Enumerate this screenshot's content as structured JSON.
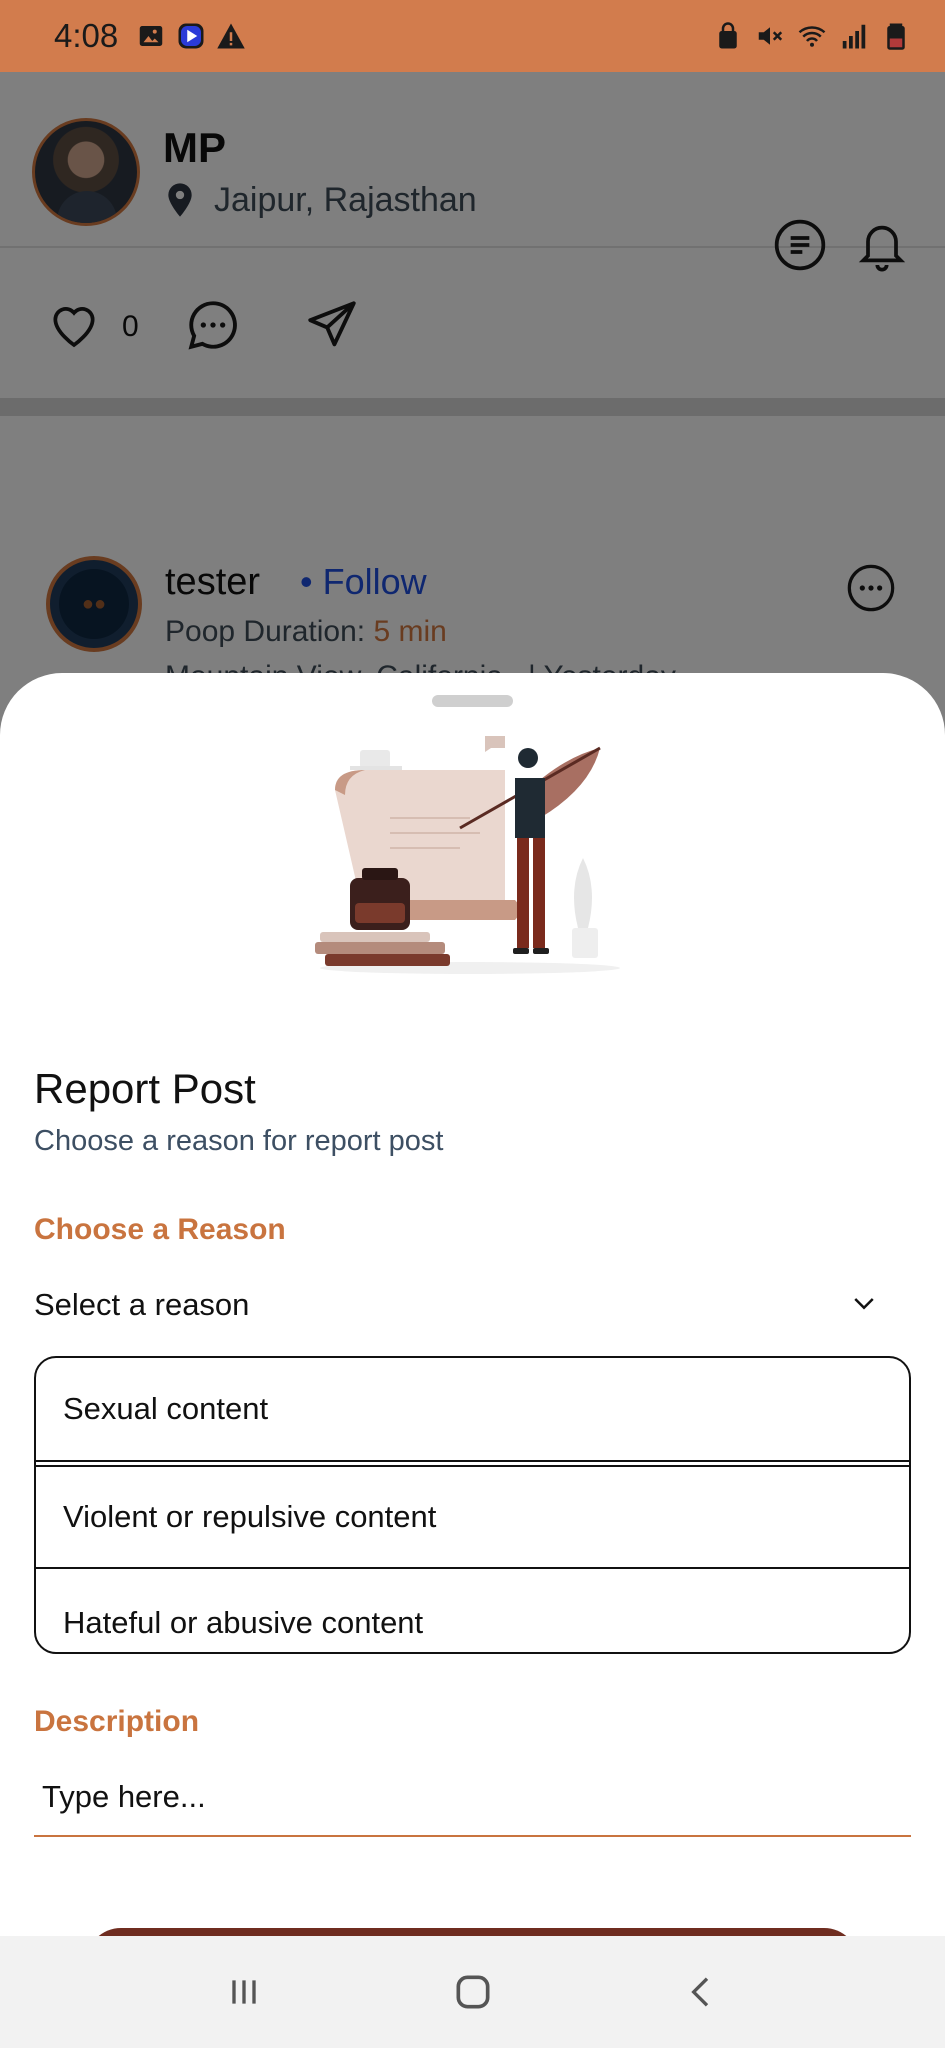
{
  "status_bar": {
    "time": "4:08",
    "left_icons": [
      "image-icon",
      "play-icon",
      "warning-icon"
    ],
    "right_icons": [
      "lock-icon",
      "mute-icon",
      "wifi-icon",
      "signal-icon",
      "battery-icon"
    ],
    "background": "#d27c4d"
  },
  "feed": {
    "post1": {
      "user_name": "MP",
      "location": "Jaipur, Rajasthan",
      "like_count": "0"
    },
    "post2": {
      "user_name": "tester",
      "follow_label": "• Follow",
      "duration_label": "Poop Duration:",
      "duration_value": "5 min",
      "location": "Mountain View, California",
      "time": "| Yesterday"
    }
  },
  "sheet": {
    "title": "Report Post",
    "subtitle": "Choose a reason for report post",
    "reason_label": "Choose a Reason",
    "select_value": "Select a reason",
    "options": [
      "Sexual content",
      "Violent or repulsive content",
      "Hateful or abusive content"
    ],
    "description_label": "Description",
    "description_placeholder": "Type here..."
  },
  "colors": {
    "accent": "#c9743f",
    "submit": "#6f2d20",
    "follow": "#1e4cd6"
  },
  "nav_bar": {
    "icons": [
      "recent-apps-icon",
      "home-icon",
      "back-icon"
    ]
  }
}
